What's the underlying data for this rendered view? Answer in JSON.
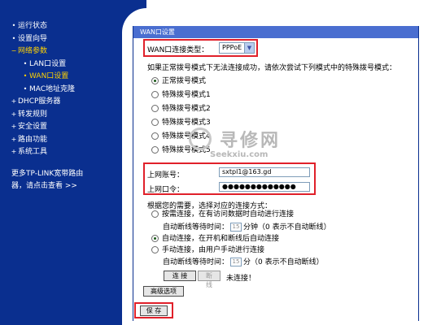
{
  "sidebar": {
    "items": [
      {
        "label": "运行状态",
        "bullet": "•",
        "level": 1,
        "active": false
      },
      {
        "label": "设置向导",
        "bullet": "•",
        "level": 1,
        "active": false
      },
      {
        "label": "网络参数",
        "bullet": "−",
        "level": 1,
        "active": true
      },
      {
        "label": "LAN口设置",
        "bullet": "•",
        "level": 2,
        "active": false
      },
      {
        "label": "WAN口设置",
        "bullet": "•",
        "level": 2,
        "active": true
      },
      {
        "label": "MAC地址克隆",
        "bullet": "•",
        "level": 2,
        "active": false
      },
      {
        "label": "DHCP服务器",
        "bullet": "+",
        "level": 1,
        "active": false
      },
      {
        "label": "转发规则",
        "bullet": "+",
        "level": 1,
        "active": false
      },
      {
        "label": "安全设置",
        "bullet": "+",
        "level": 1,
        "active": false
      },
      {
        "label": "路由功能",
        "bullet": "+",
        "level": 1,
        "active": false
      },
      {
        "label": "系统工具",
        "bullet": "+",
        "level": 1,
        "active": false
      }
    ],
    "more_link_line1": "更多TP-LINK宽带路由",
    "more_link_line2": "器，请点击查看 >>"
  },
  "panel": {
    "title": "WAN口设置",
    "conn_type_label": "WAN口连接类型：",
    "conn_type_value": "PPPoE",
    "special_hint": "如果正常拨号模式下无法连接成功，请依次尝试下列模式中的特殊拨号模式：",
    "dial_modes": [
      {
        "label": "正常拨号模式",
        "checked": true
      },
      {
        "label": "特殊拨号模式1",
        "checked": false
      },
      {
        "label": "特殊拨号模式2",
        "checked": false
      },
      {
        "label": "特殊拨号模式3",
        "checked": false
      },
      {
        "label": "特殊拨号模式4",
        "checked": false
      },
      {
        "label": "特殊拨号模式5",
        "checked": false
      }
    ],
    "account_label": "上网账号：",
    "account_value": "sxtpl1@163.gd",
    "password_label": "上网口令：",
    "password_value": "●●●●●●●●●●●●●",
    "connect_hint": "根据您的需要，选择对应的连接方式：",
    "connect_modes": [
      {
        "label": "按需连接，在有访问数据时自动进行连接",
        "checked": false
      },
      {
        "label": "自动连接，在开机和断线后自动连接",
        "checked": true
      },
      {
        "label": "手动连接，由用户手动进行连接",
        "checked": false
      }
    ],
    "idle_label": "自动断线等待时间：",
    "idle_value_1": "15",
    "idle_unit_1": "分钟（0 表示不自动断线）",
    "idle_value_2": "15",
    "idle_unit_2": "分（0 表示不自动断线）",
    "connect_button": "连 接",
    "disconnect_button": "断 线",
    "status_text": "未连接！",
    "advanced_button": "高级选项",
    "save_button": "保 存"
  },
  "watermark": {
    "text": "寻修网",
    "url": "Seekxiu.com"
  },
  "colors": {
    "sidebar_bg": "#0a2f8f",
    "active_text": "#ffd200",
    "highlight_box": "#e0202a",
    "title_bar": "#4a6ed0"
  }
}
